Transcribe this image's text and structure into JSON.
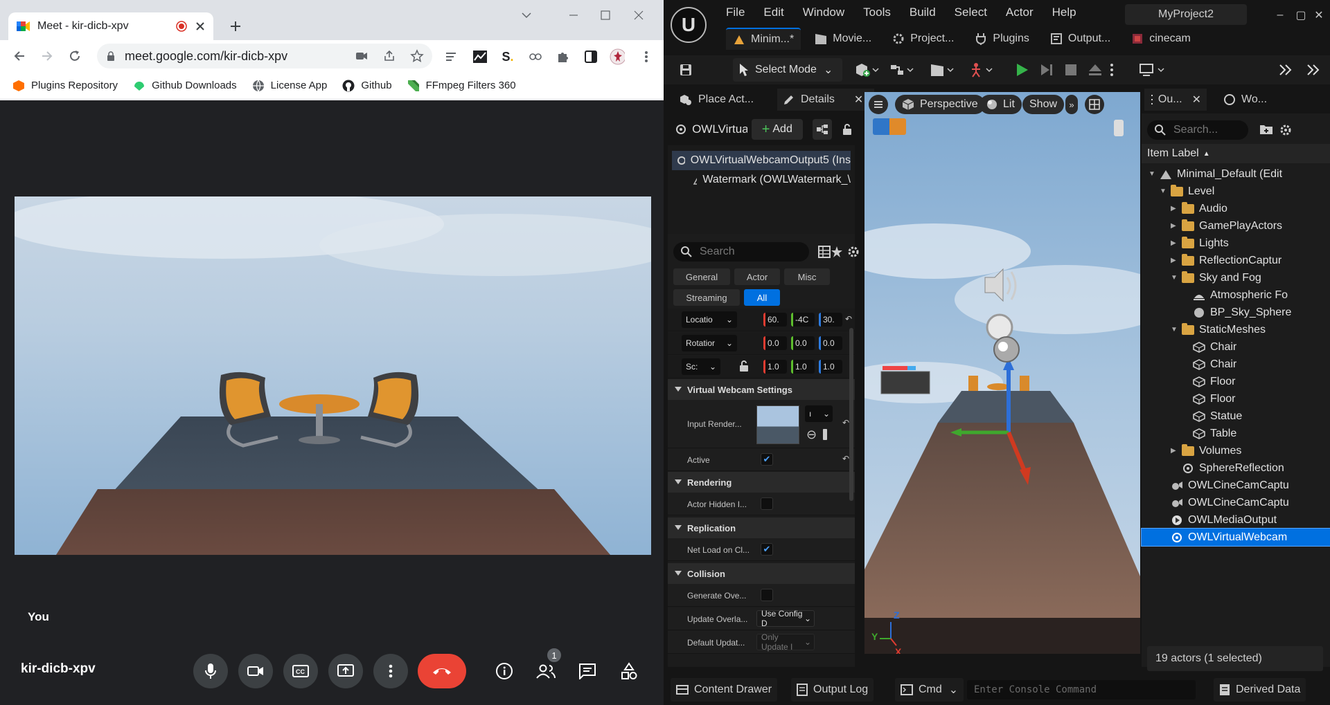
{
  "chrome": {
    "tab_title": "Meet - kir-dicb-xpv",
    "url": "meet.google.com/kir-dicb-xpv",
    "bookmarks": [
      "Plugins Repository",
      "Github Downloads",
      "License App",
      "Github",
      "FFmpeg Filters 360"
    ],
    "bookmark_icon_colors": [
      "#ff6f00",
      "#2ecc71",
      "#5f6368",
      "#202124",
      "#4caf50"
    ]
  },
  "meet": {
    "self_label": "You",
    "meeting_code": "kir-dicb-xpv",
    "participant_count": "1",
    "end_call_color": "#ea4335"
  },
  "unreal": {
    "menu": [
      "File",
      "Edit",
      "Window",
      "Tools",
      "Build",
      "Select",
      "Actor",
      "Help"
    ],
    "project": "MyProject2",
    "tabs": [
      "Minim...*",
      "Movie...",
      "Project...",
      "Plugins",
      "Output...",
      "cinecam"
    ],
    "toolbar": {
      "select_mode": "Select Mode"
    },
    "panels": {
      "place_actors": "Place Act...",
      "details": "Details",
      "outliner": "Ou...",
      "world": "Wo..."
    },
    "details": {
      "actor_name": "OWLVirtua",
      "add_label": "Add",
      "components": [
        "OWLVirtualWebcamOutput5 (Ins",
        "Watermark (OWLWatermark_\\"
      ],
      "search_placeholder": "Search",
      "filters": [
        "General",
        "Actor",
        "Misc",
        "Streaming",
        "All"
      ],
      "transform": {
        "location_label": "Locatio",
        "rotation_label": "Rotatior",
        "scale_label": "Sc:",
        "location": [
          "60.",
          "-4C",
          "30."
        ],
        "rotation": [
          "0.0",
          "0.0",
          "0.0"
        ],
        "scale": [
          "1.0",
          "1.0",
          "1.0"
        ]
      },
      "sections": {
        "virtual_webcam": "Virtual Webcam Settings",
        "rendering": "Rendering",
        "replication": "Replication",
        "collision": "Collision"
      },
      "props": {
        "input_render": "Input Render...",
        "input_render_value": "ı",
        "active": "Active",
        "actor_hidden": "Actor Hidden I...",
        "net_load": "Net Load on Cl...",
        "generate_overlap": "Generate Ove...",
        "update_overlap": "Update Overla...",
        "update_overlap_value": "Use Config D",
        "default_update": "Default Updat...",
        "default_update_value": "Only Update I"
      }
    },
    "viewport": {
      "perspective": "Perspective",
      "lit": "Lit",
      "show": "Show",
      "axis_x": "X",
      "axis_y": "Y",
      "axis_z": "Z"
    },
    "outliner": {
      "search_placeholder": "Search...",
      "column": "Item Label",
      "items": [
        "Minimal_Default (Edit",
        "Level",
        "Audio",
        "GamePlayActors",
        "Lights",
        "ReflectionCaptur",
        "Sky and Fog",
        "Atmospheric Fo",
        "BP_Sky_Sphere",
        "StaticMeshes",
        "Chair",
        "Chair",
        "Floor",
        "Floor",
        "Statue",
        "Table",
        "Volumes",
        "SphereReflection",
        "OWLCineCamCaptu",
        "OWLCineCamCaptu",
        "OWLMediaOutput",
        "OWLVirtualWebcam"
      ],
      "status": "19 actors (1 selected)"
    },
    "bottom": {
      "content_drawer": "Content Drawer",
      "output_log": "Output Log",
      "cmd": "Cmd",
      "console_placeholder": "Enter Console Command",
      "derived_data": "Derived Data"
    },
    "accent": "#0070e0"
  }
}
